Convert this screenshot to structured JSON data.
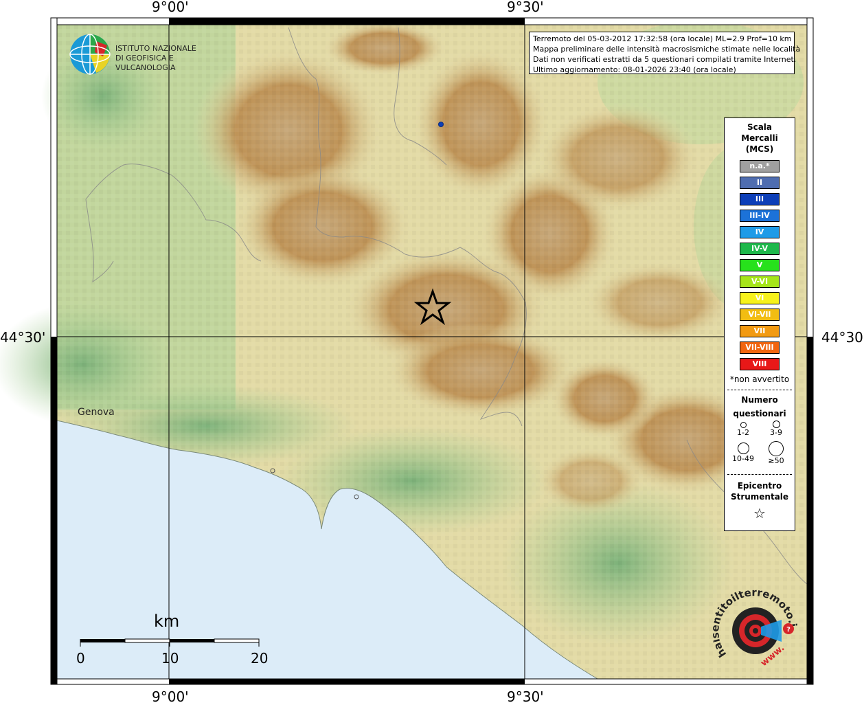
{
  "map": {
    "coord_labels": {
      "lon_left": "9°00'",
      "lon_right": "9°30'",
      "lat": "44°30'"
    },
    "city": "Genova",
    "colors": {
      "sea": "#dcecf8",
      "lowland": "#8fc08a",
      "hills": "#e6dca6",
      "mountains": "#b98c4f",
      "peaks": "#d7c3a0"
    }
  },
  "header": {
    "institute_line1": "ISTITUTO NAZIONALE",
    "institute_line2": "DI GEOFISICA E VULCANOLOGIA"
  },
  "info": {
    "line1": "Terremoto del 05-03-2012 17:32:58 (ora locale) ML=2.9 Prof=10 km",
    "line2": "Mappa preliminare delle intensità macrosismiche stimate nelle località",
    "line3": "Dati non verificati estratti da 5 questionari compilati tramite Internet.",
    "line4": "Ultimo aggiornamento: 08-01-2026 23:40 (ora locale)"
  },
  "legend": {
    "title": "Scala Mercalli (MCS)",
    "items": [
      {
        "label": "n.a.*",
        "color": "#a0a0a0"
      },
      {
        "label": "II",
        "color": "#4f6db0"
      },
      {
        "label": "III",
        "color": "#0d3fb8"
      },
      {
        "label": "III-IV",
        "color": "#1c72d8"
      },
      {
        "label": "IV",
        "color": "#1e9be8"
      },
      {
        "label": "IV-V",
        "color": "#1eb84b"
      },
      {
        "label": "V",
        "color": "#27e11c"
      },
      {
        "label": "V-VI",
        "color": "#a6e51a"
      },
      {
        "label": "VI",
        "color": "#f7f21c"
      },
      {
        "label": "VI-VII",
        "color": "#f2bd12"
      },
      {
        "label": "VII",
        "color": "#f29a12"
      },
      {
        "label": "VII-VIII",
        "color": "#f2650f"
      },
      {
        "label": "VIII",
        "color": "#e81818"
      }
    ],
    "note": "*non avvertito",
    "questionnaires_title": "Numero questionari",
    "q_sizes": [
      "1-2",
      "3-9",
      "10-49",
      "≥50"
    ],
    "epicenter_title": "Epicentro Strumentale"
  },
  "scalebar": {
    "unit": "km",
    "ticks": [
      "0",
      "10",
      "20"
    ]
  },
  "hsit_logo": {
    "text": "haisentitoilterremoto.it",
    "prefix": "www."
  }
}
